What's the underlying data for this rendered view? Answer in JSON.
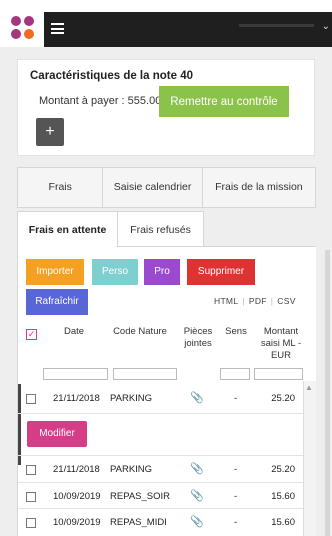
{
  "card": {
    "title": "Caractéristiques de la note 40",
    "amount_label": "Montant à payer : 555.00",
    "remit_button": "Remettre au contrôle",
    "add_button": "+"
  },
  "tabs_main": [
    {
      "label": "Frais"
    },
    {
      "label": "Saisie calendrier"
    },
    {
      "label": "Frais de la mission"
    }
  ],
  "tabs_sub": {
    "pending": "Frais en attente",
    "refused": "Frais refusés"
  },
  "actions": {
    "import": "Importer",
    "perso": "Perso",
    "pro": "Pro",
    "delete": "Supprimer",
    "refresh": "Rafraîchir",
    "modify": "Modifier"
  },
  "colors": {
    "import": "#f4a020",
    "perso": "#7ecfd0",
    "pro": "#9b4ad0",
    "delete": "#dd3433",
    "refresh": "#5866d6",
    "modify": "#d63d87",
    "green": "#8bc34a"
  },
  "exports": {
    "html": "HTML",
    "pdf": "PDF",
    "csv": "CSV"
  },
  "table": {
    "col_date": "Date",
    "col_code": "Code Nature",
    "col_pieces_1": "Pièces",
    "col_pieces_2": "jointes",
    "col_sens": "Sens",
    "col_montant_1": "Montant",
    "col_montant_2": "saisi ML -",
    "col_montant_3": "EUR",
    "rows": [
      {
        "date": "21/11/2018",
        "code": "PARKING",
        "sens": "-",
        "montant": "25.20"
      },
      {
        "date": "21/11/2018",
        "code": "PARKING",
        "sens": "-",
        "montant": "25.20"
      },
      {
        "date": "10/09/2019",
        "code": "REPAS_SOIR",
        "sens": "-",
        "montant": "15.60"
      },
      {
        "date": "10/09/2019",
        "code": "REPAS_MIDI",
        "sens": "-",
        "montant": "15.60"
      }
    ]
  }
}
